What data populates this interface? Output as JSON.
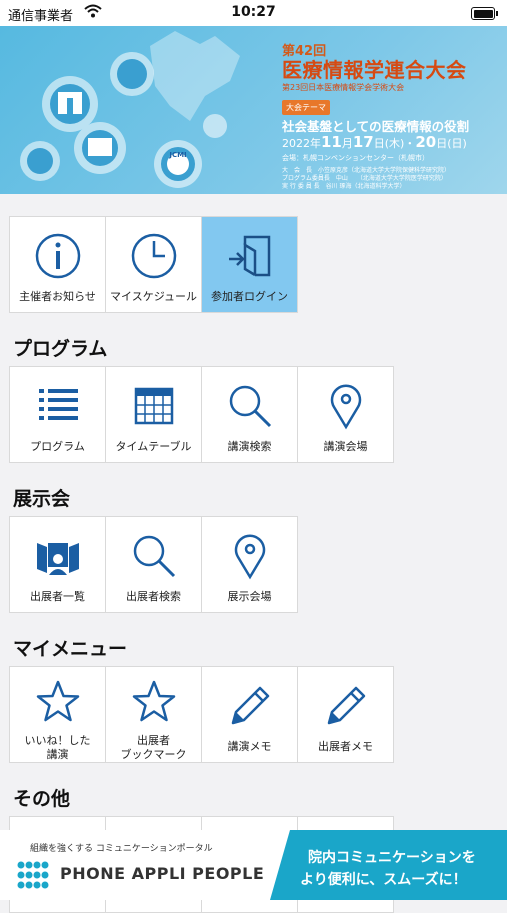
{
  "status_bar": {
    "carrier": "通信事業者",
    "time": "10:27"
  },
  "banner": {
    "edition": "第42回",
    "title": "医療情報学連合大会",
    "subtitle": "第23回日本医療情報学会学術大会",
    "theme_badge": "大会テーマ",
    "theme": "社会基盤としての医療情報の役割",
    "date_year": "2022年",
    "date_month": "11",
    "date_m_unit": "月",
    "date_start": "17",
    "date_start_dow": "日(木)・",
    "date_end": "20",
    "date_end_dow": "日(日)",
    "venue": "会場：札幌コンベンションセンター（札幌市）",
    "info_lines": [
      "大　会　長　小笠原克彦（北海道大学大学院保健科学研究院）",
      "プログラム委員長　中山　　（北海道大学大学院医学研究院）",
      "実 行 委 員 長　谷川 琢海（北海道科学大学）"
    ],
    "logo_text": "JCMI"
  },
  "top_tiles": [
    {
      "label": "主催者お知らせ",
      "icon": "info-icon"
    },
    {
      "label": "マイスケジュール",
      "icon": "clock-icon"
    },
    {
      "label": "参加者ログイン",
      "icon": "login-icon"
    }
  ],
  "sections": {
    "program": {
      "title": "プログラム",
      "tiles": [
        {
          "label": "プログラム",
          "icon": "list-icon"
        },
        {
          "label": "タイムテーブル",
          "icon": "calendar-icon"
        },
        {
          "label": "講演検索",
          "icon": "search-icon"
        },
        {
          "label": "講演会場",
          "icon": "map-pin-icon"
        }
      ]
    },
    "exhibition": {
      "title": "展示会",
      "tiles": [
        {
          "label": "出展者一覧",
          "icon": "exhibitor-icon"
        },
        {
          "label": "出展者検索",
          "icon": "search-icon"
        },
        {
          "label": "展示会場",
          "icon": "map-pin-icon"
        }
      ]
    },
    "my_menu": {
      "title": "マイメニュー",
      "tiles": [
        {
          "label_line1": "いいね！した",
          "label_line2": "講演",
          "icon": "star-icon"
        },
        {
          "label_line1": "出展者",
          "label_line2": "ブックマーク",
          "icon": "star-icon"
        },
        {
          "label": "講演メモ",
          "icon": "pencil-icon"
        },
        {
          "label": "出展者メモ",
          "icon": "pencil-icon"
        }
      ]
    },
    "other": {
      "title": "その他"
    }
  },
  "ad": {
    "tagline": "組織を強くする コミュニケーションポータル",
    "brand": "PHONE APPLI PEOPLE",
    "cta_line1": "院内コミュニケーションを",
    "cta_line2": "より便利に、スムーズに！"
  },
  "colors": {
    "accent": "#1b5ea3",
    "active_tile": "#82c8f0",
    "banner": "#56b9e0",
    "ad_cta": "#1aa6c9"
  }
}
